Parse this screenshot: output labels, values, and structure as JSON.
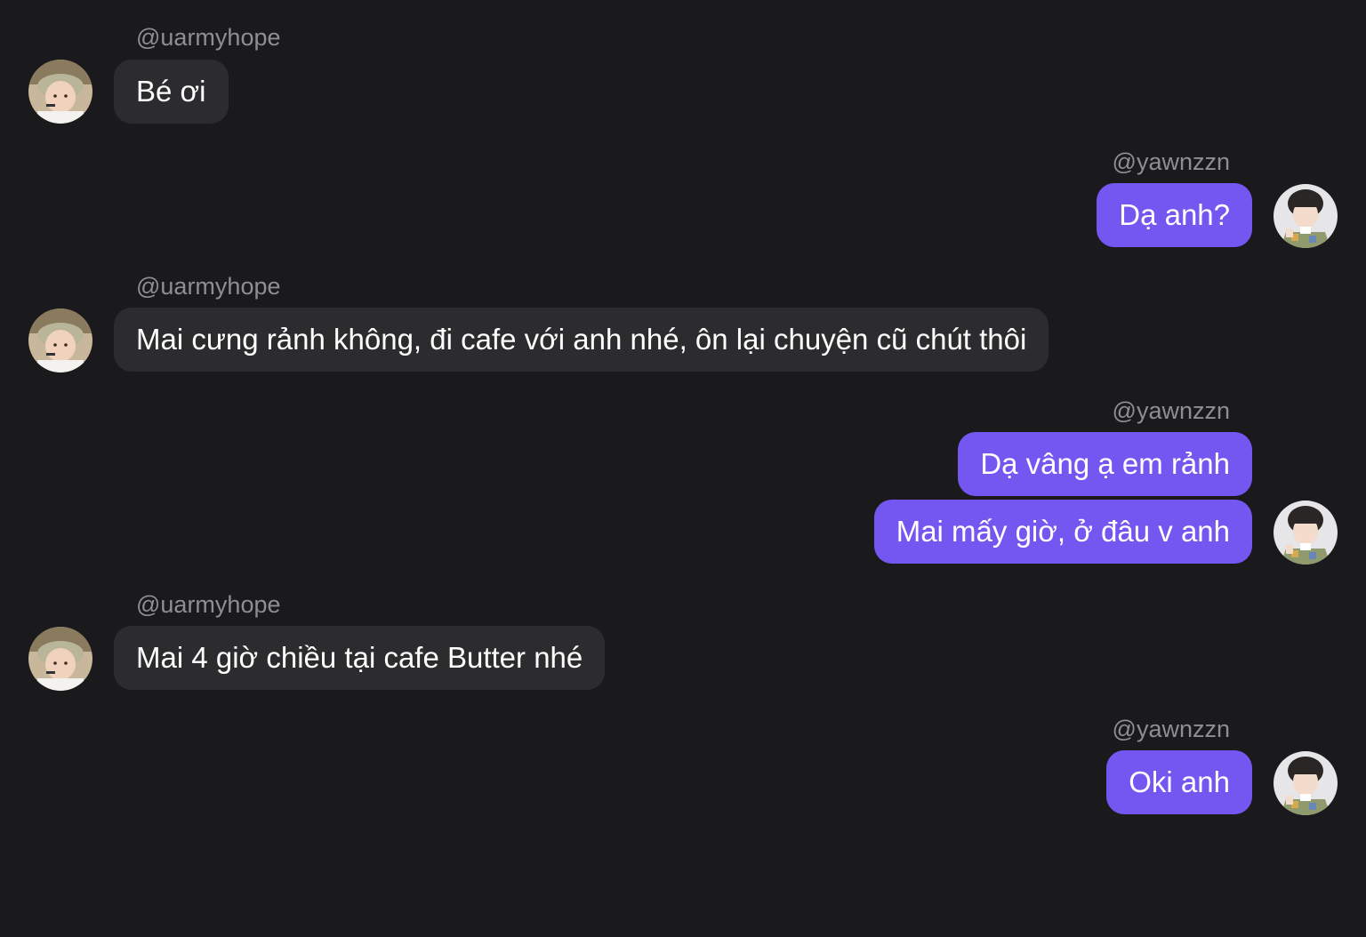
{
  "users": {
    "left": "@uarmyhope",
    "right": "@yawnzzn"
  },
  "messages": [
    {
      "sender": "@uarmyhope",
      "text": "Bé ơi"
    },
    {
      "sender": "@yawnzzn",
      "text": "Dạ anh?"
    },
    {
      "sender": "@uarmyhope",
      "text": "Mai cưng rảnh không, đi cafe với anh nhé, ôn lại chuyện cũ chút thôi"
    },
    {
      "sender": "@yawnzzn",
      "text": "Dạ vâng ạ em rảnh"
    },
    {
      "sender": "@yawnzzn",
      "text": "Mai mấy giờ, ở đâu v anh"
    },
    {
      "sender": "@uarmyhope",
      "text": "Mai 4 giờ chiều tại cafe Butter nhé"
    },
    {
      "sender": "@yawnzzn",
      "text": "Oki anh"
    }
  ],
  "colors": {
    "background": "#1a1a1c",
    "incoming_bubble": "#2c2c2e",
    "outgoing_bubble": "#7357f0",
    "username": "#8e8e93",
    "text": "#ffffff"
  },
  "icons": {
    "left_avatar": "avatar-photo-uarmyhope",
    "right_avatar": "avatar-photo-yawnzzn"
  }
}
